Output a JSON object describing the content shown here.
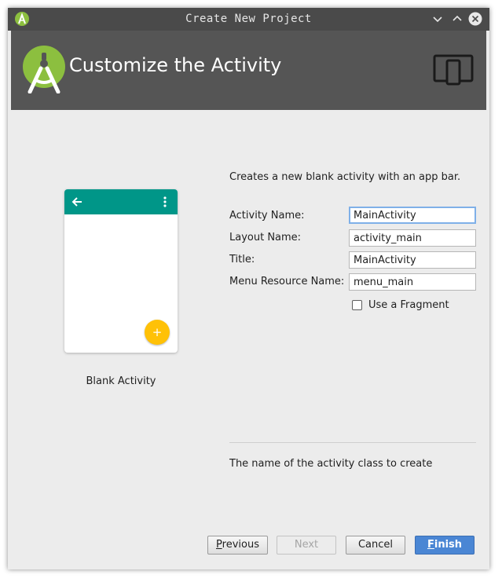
{
  "window": {
    "title": "Create New Project"
  },
  "banner": {
    "title": "Customize the Activity"
  },
  "template": {
    "name": "Blank Activity",
    "appbar_color": "#009688",
    "fab_color": "#ffc107",
    "fab_icon": "+"
  },
  "description": "Creates a new blank activity with an app bar.",
  "form": {
    "activity_name": {
      "label": "Activity Name:",
      "value": "MainActivity"
    },
    "layout_name": {
      "label": "Layout Name:",
      "value": "activity_main"
    },
    "title": {
      "label": "Title:",
      "value": "MainActivity"
    },
    "menu_resource_name": {
      "label": "Menu Resource Name:",
      "value": "menu_main"
    },
    "use_fragment": {
      "label": "Use a Fragment",
      "checked": false
    }
  },
  "hint": "The name of the activity class to create",
  "buttons": {
    "previous": {
      "first": "P",
      "rest": "revious"
    },
    "next": "Next",
    "cancel": "Cancel",
    "finish": {
      "first": "F",
      "rest": "inish"
    }
  },
  "colors": {
    "banner_bg": "#555555",
    "accent": "#4a86d4",
    "android_green": "#8cbf3f"
  }
}
